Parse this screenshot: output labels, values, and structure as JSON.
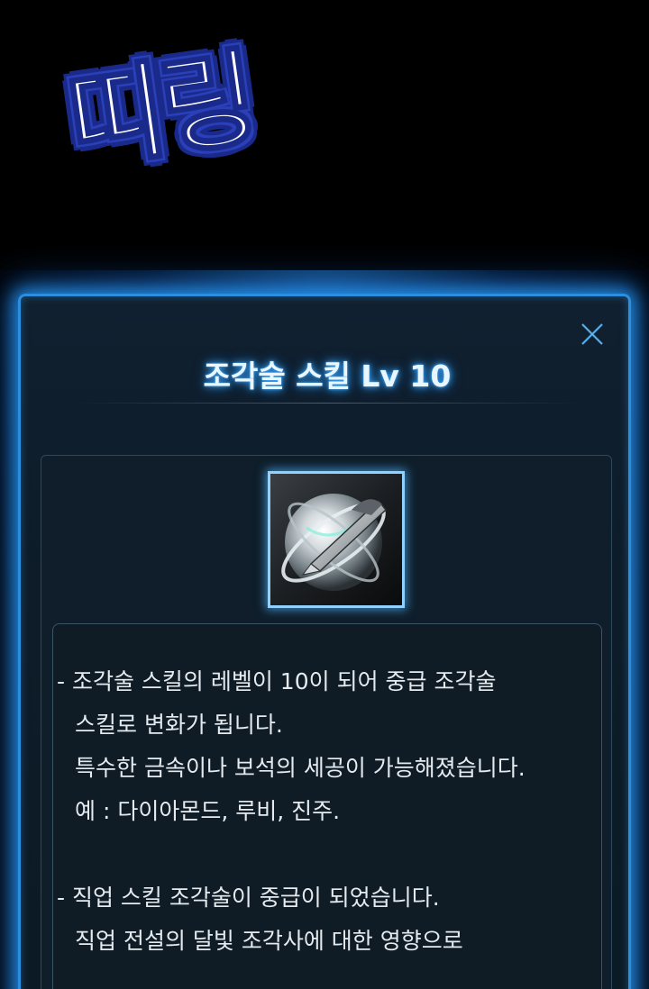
{
  "sfx_text": "띠링",
  "dialog": {
    "title": "조각술 스킬 Lv 10",
    "close_label": "×",
    "skill_icon": "engraving-chisel-orb-icon",
    "description": {
      "para1_line1": "- 조각술 스킬의 레벨이 10이 되어 중급 조각술",
      "para1_line2": "스킬로 변화가 됩니다.",
      "para1_line3": "특수한 금속이나 보석의 세공이 가능해졌습니다.",
      "para1_line4": "예 : 다이아몬드, 루비, 진주.",
      "para2_line1": "- 직업 스킬 조각술이 중급이 되었습니다.",
      "para2_line2": "직업 전설의 달빛 조각사에 대한 영향으로"
    }
  },
  "colors": {
    "window_border": "#2a8fe0",
    "glow": "#28a0ff",
    "window_bg": "#0d1c28",
    "text": "#e4eaee",
    "sfx_outline": "#1a2a8a"
  }
}
